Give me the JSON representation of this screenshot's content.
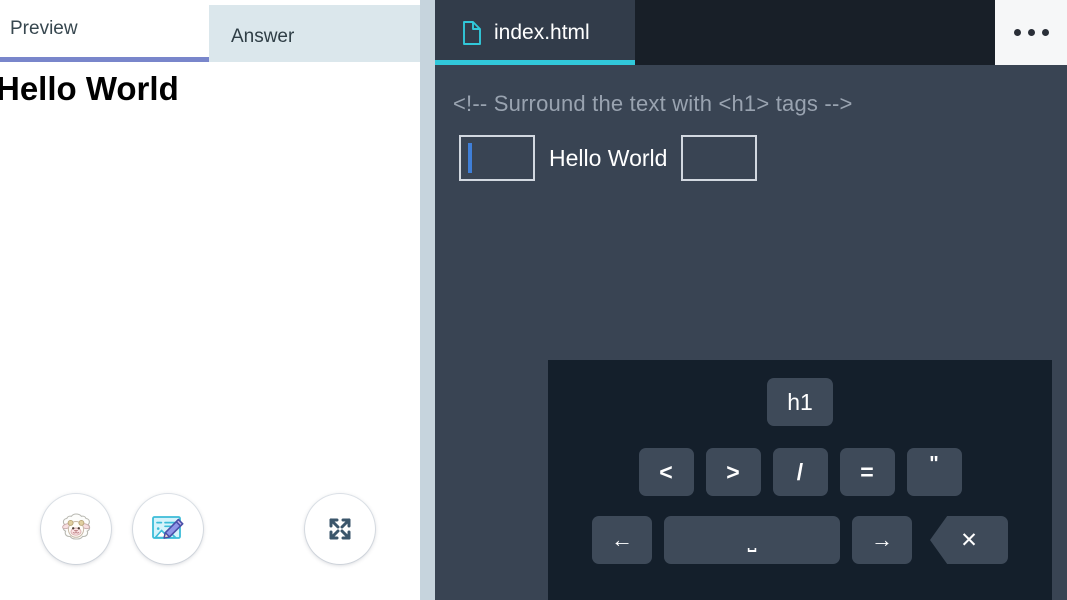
{
  "left_panel": {
    "tabs": [
      {
        "id": "preview",
        "label": "Preview",
        "active": true
      },
      {
        "id": "answer",
        "label": "Answer",
        "active": false
      }
    ],
    "preview_content": {
      "heading": "Hello World"
    },
    "tool_buttons": [
      {
        "id": "mascot",
        "icon": "sheep-icon",
        "label": ""
      },
      {
        "id": "draw",
        "icon": "image-edit-icon",
        "label": ""
      },
      {
        "id": "fullscreen",
        "icon": "fullscreen-expand-icon",
        "label": ""
      }
    ]
  },
  "editor": {
    "file_tab": {
      "name": "index.html",
      "icon": "file-document-icon",
      "active": true
    },
    "menu_button": {
      "icon": "ellipsis-icon",
      "label": "..."
    },
    "code": {
      "comment": "<!-- Surround the text with <h1> tags -->",
      "line": {
        "blank_before": "",
        "text": "Hello World",
        "blank_after": ""
      }
    }
  },
  "keyboard": {
    "tag_keys": [
      {
        "label": "h1",
        "name": "key-h1"
      }
    ],
    "symbol_keys": [
      {
        "label": "<",
        "name": "key-less-than"
      },
      {
        "label": ">",
        "name": "key-greater-than"
      },
      {
        "label": "/",
        "name": "key-slash"
      },
      {
        "label": "=",
        "name": "key-equals"
      },
      {
        "label": "\"",
        "name": "key-quote"
      }
    ],
    "action_keys": [
      {
        "label": "←",
        "name": "key-arrow-left"
      },
      {
        "label": "⎵",
        "name": "key-space"
      },
      {
        "label": "→",
        "name": "key-arrow-right"
      },
      {
        "label": "✕",
        "name": "key-backspace"
      }
    ]
  },
  "colors": {
    "active_tab_underline": "#7986cb",
    "answer_tab_bg": "#dbe7ec",
    "divider": "#c6d4dd",
    "editor_bg": "#394453",
    "editor_tabbar_bg": "#181f28",
    "file_tab_bg": "#323c4a",
    "file_tab_accent": "#31c8da",
    "keyboard_bg": "#141f2b",
    "key_bg": "#3e4a59",
    "comment_text": "#99a3b0",
    "caret": "#3f7fd8"
  }
}
